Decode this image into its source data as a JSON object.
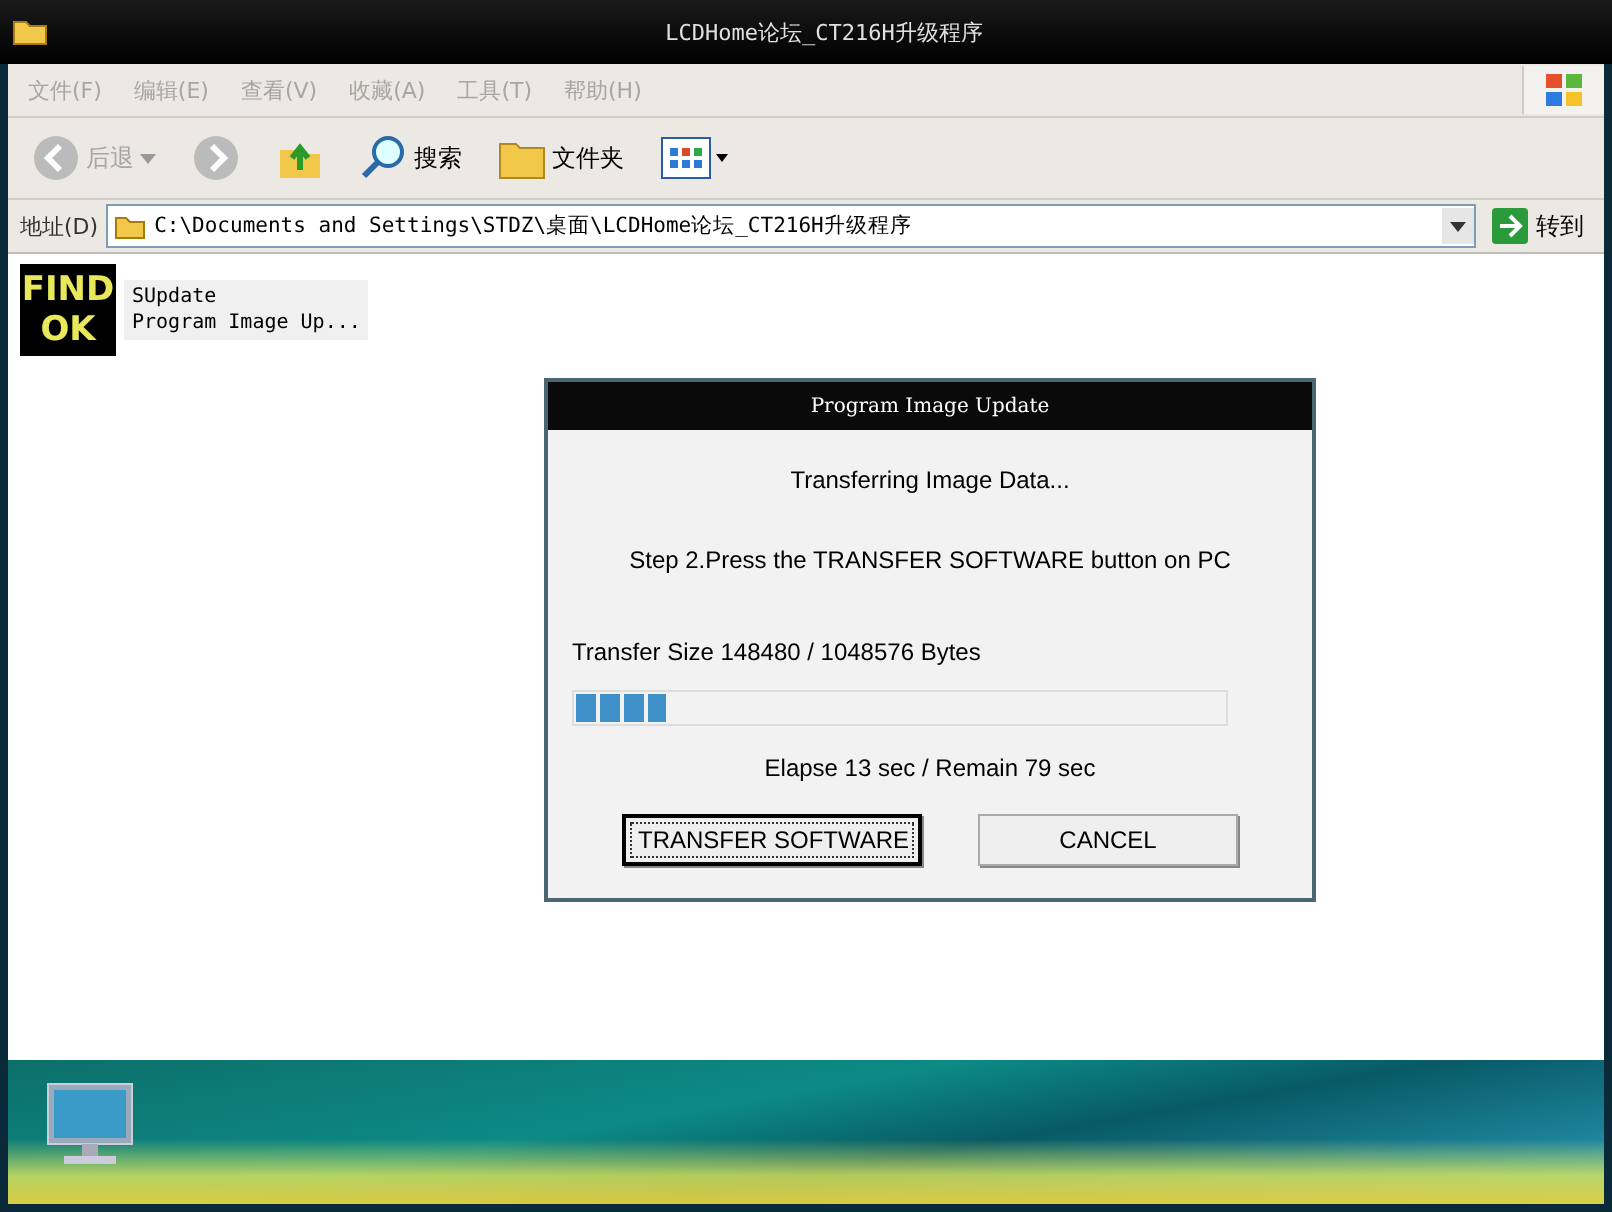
{
  "window": {
    "title": "LCDHome论坛_CT216H升级程序"
  },
  "menu": [
    {
      "label": "文件(F)",
      "disabled": true
    },
    {
      "label": "编辑(E)",
      "disabled": true
    },
    {
      "label": "查看(V)",
      "disabled": true
    },
    {
      "label": "收藏(A)",
      "disabled": true
    },
    {
      "label": "工具(T)",
      "disabled": true
    },
    {
      "label": "帮助(H)",
      "disabled": true
    }
  ],
  "toolbar": {
    "back": {
      "label": "后退",
      "disabled": true
    },
    "search": "搜索",
    "folders": "文件夹"
  },
  "address": {
    "label": "地址(D)",
    "value": "C:\\Documents and Settings\\STDZ\\桌面\\LCDHome论坛_CT216H升级程序",
    "go": "转到"
  },
  "file": {
    "icon_lines": [
      "FIND",
      "OK"
    ],
    "name": "SUpdate",
    "description": "Program Image Up..."
  },
  "dialog": {
    "title": "Program Image Update",
    "status": "Transferring Image Data...",
    "instruction": "Step 2.Press the TRANSFER SOFTWARE button on PC",
    "size": "Transfer Size 148480 / 1048576 Bytes",
    "progress": {
      "level": 0.14
    },
    "time": "Elapse 13 sec / Remain 79 sec",
    "buttons": [
      {
        "label": "TRANSFER SOFTWARE",
        "focused": true
      },
      {
        "label": "CANCEL",
        "focused": false
      }
    ]
  }
}
